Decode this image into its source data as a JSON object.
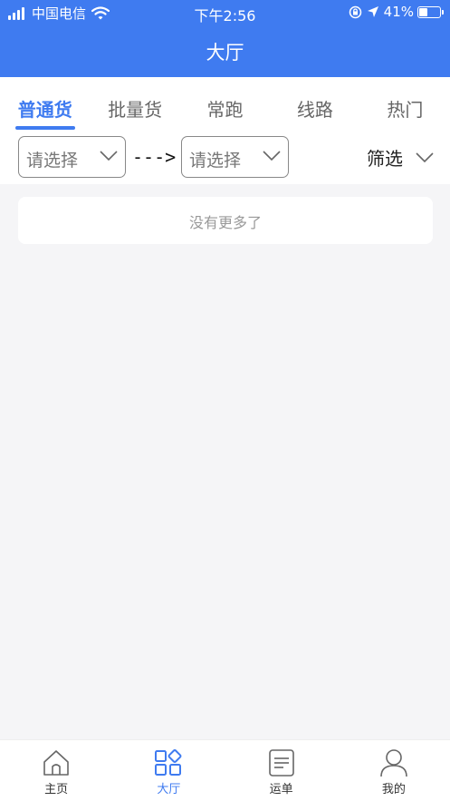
{
  "status_bar": {
    "carrier": "中国电信",
    "time": "下午2:56",
    "battery": "41%",
    "battery_level": 0.41
  },
  "header": {
    "title": "大厅"
  },
  "tabs": [
    {
      "label": "普通货",
      "active": true
    },
    {
      "label": "批量货",
      "active": false
    },
    {
      "label": "常跑",
      "active": false
    },
    {
      "label": "线路",
      "active": false
    },
    {
      "label": "热门",
      "active": false
    }
  ],
  "filter": {
    "from_placeholder": "请选择",
    "arrow": "--->",
    "to_placeholder": "请选择",
    "filter_label": "筛选"
  },
  "list": {
    "empty_text": "没有更多了"
  },
  "tabbar": [
    {
      "label": "主页",
      "icon": "home-icon",
      "active": false
    },
    {
      "label": "大厅",
      "icon": "grid-icon",
      "active": true
    },
    {
      "label": "运单",
      "icon": "document-icon",
      "active": false
    },
    {
      "label": "我的",
      "icon": "user-icon",
      "active": false
    }
  ],
  "colors": {
    "brand": "#3f7bf0",
    "background": "#f5f5f7"
  }
}
